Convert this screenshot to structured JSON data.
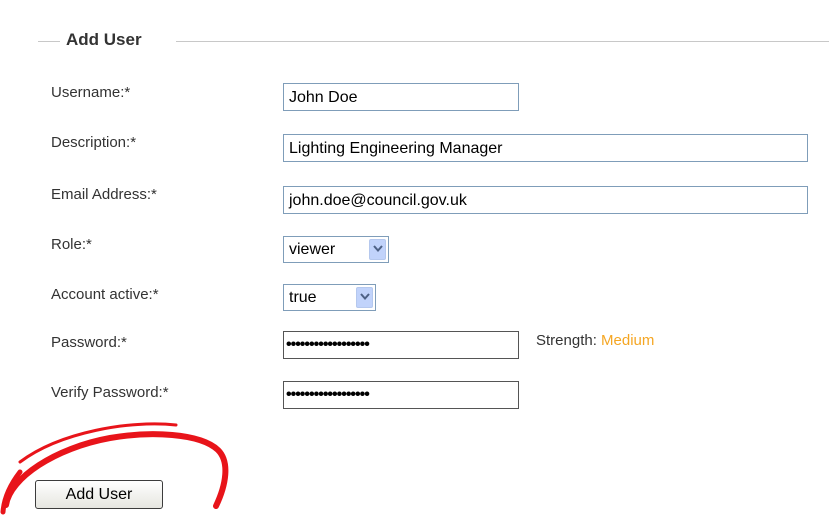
{
  "form": {
    "legend": "Add User",
    "fields": [
      {
        "label": "Username:*",
        "value": "John Doe"
      },
      {
        "label": "Description:*",
        "value": "Lighting Engineering Manager"
      },
      {
        "label": "Email Address:*",
        "value": "john.doe@council.gov.uk"
      },
      {
        "label": "Role:*",
        "value": "viewer"
      },
      {
        "label": "Account active:*",
        "value": "true"
      },
      {
        "label": "Password:*",
        "value": "••••••••••••••••••"
      },
      {
        "label": "Verify Password:*",
        "value": "••••••••••••••••••"
      }
    ],
    "strength": {
      "label": "Strength:",
      "level": "Medium",
      "level_color": "#f5a623"
    },
    "submit_label": "Add User"
  },
  "annotation": {
    "color": "#e8141a",
    "shape": "hand-drawn circle around submit button"
  }
}
